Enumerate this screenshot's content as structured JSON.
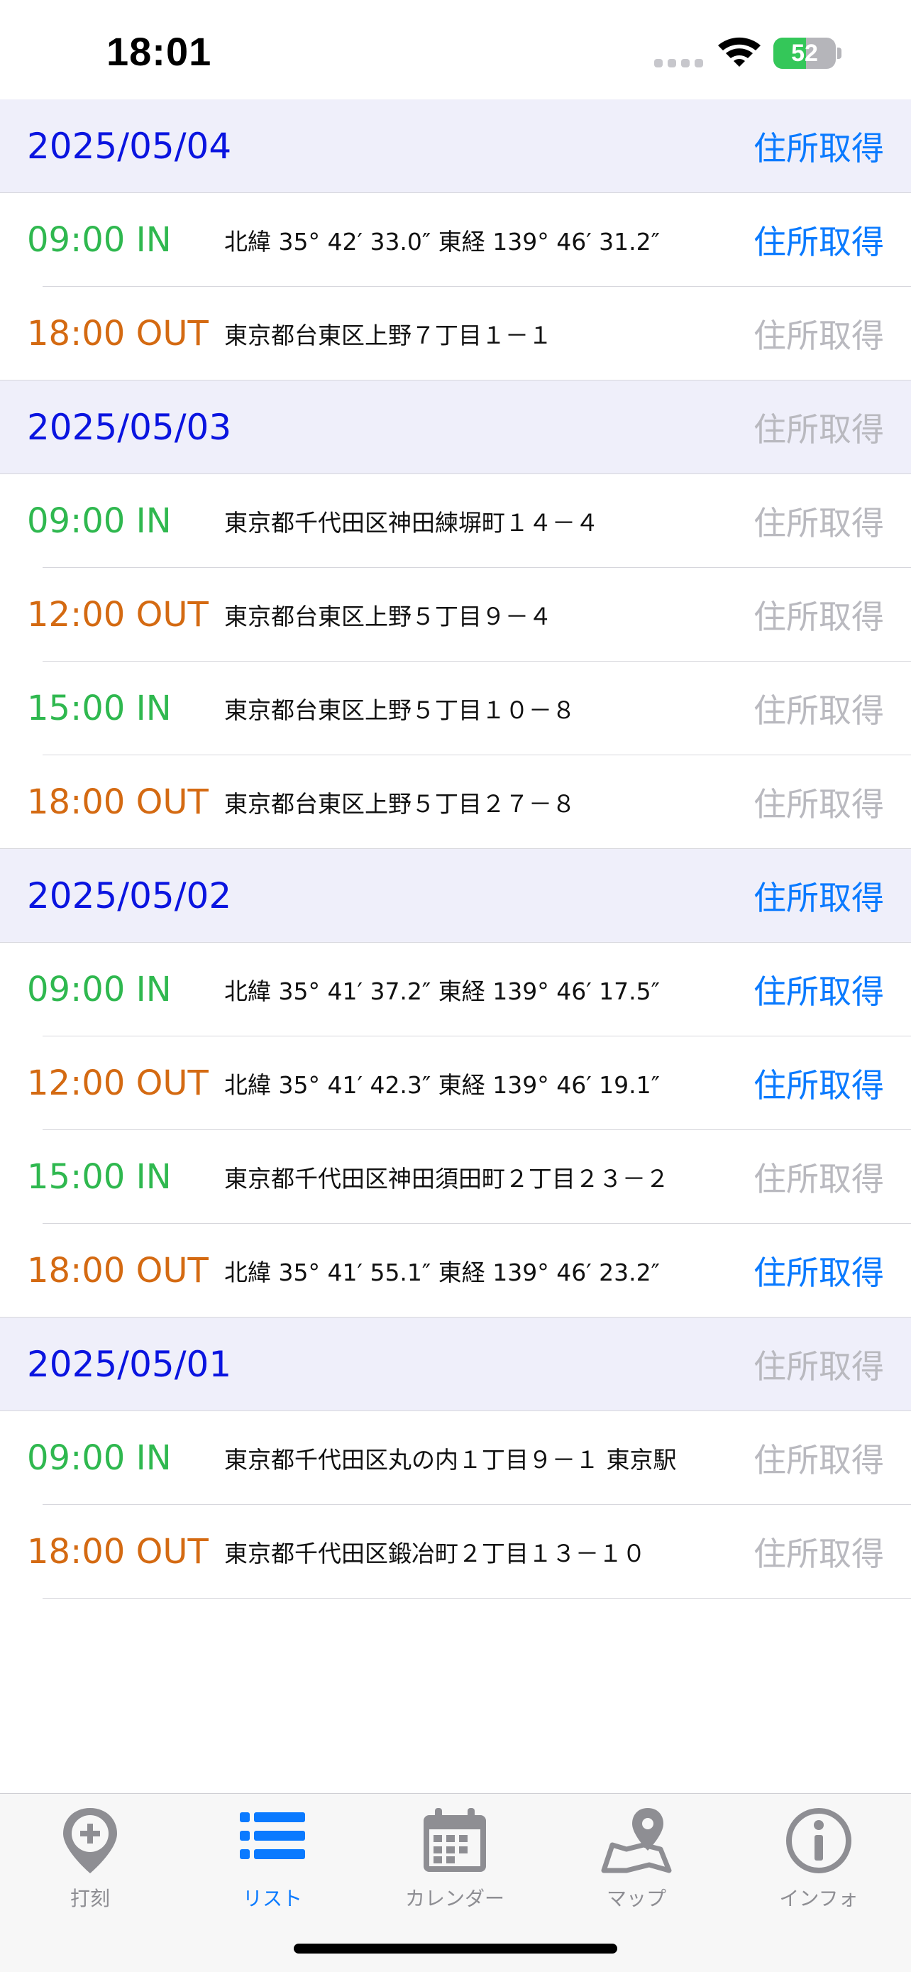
{
  "status_bar": {
    "time": "18:01",
    "battery_level": "52",
    "battery_percent": 52,
    "battery_color": "#34c759"
  },
  "colors": {
    "date_text": "#0a14e0",
    "header_bg": "#efeffa",
    "in_color": "#2fb84f",
    "out_color": "#d46a12",
    "action_enabled": "#0a7aff",
    "action_disabled": "#b9b9bf",
    "tab_active": "#0a7aff",
    "tab_inactive": "#8e8e93"
  },
  "groups": [
    {
      "date": "2025/05/04",
      "action_label": "住所取得",
      "action_enabled": true,
      "entries": [
        {
          "time": "09:00 IN",
          "kind": "in",
          "address": "北緯 35° 42′ 33.0″ 東経 139° 46′ 31.2″",
          "action_label": "住所取得",
          "action_enabled": true
        },
        {
          "time": "18:00 OUT",
          "kind": "out",
          "address": "東京都台東区上野７丁目１－１",
          "action_label": "住所取得",
          "action_enabled": false
        }
      ]
    },
    {
      "date": "2025/05/03",
      "action_label": "住所取得",
      "action_enabled": false,
      "entries": [
        {
          "time": "09:00 IN",
          "kind": "in",
          "address": "東京都千代田区神田練塀町１４－４",
          "action_label": "住所取得",
          "action_enabled": false
        },
        {
          "time": "12:00 OUT",
          "kind": "out",
          "address": "東京都台東区上野５丁目９－４",
          "action_label": "住所取得",
          "action_enabled": false
        },
        {
          "time": "15:00 IN",
          "kind": "in",
          "address": "東京都台東区上野５丁目１０－８",
          "action_label": "住所取得",
          "action_enabled": false
        },
        {
          "time": "18:00 OUT",
          "kind": "out",
          "address": "東京都台東区上野５丁目２７－８",
          "action_label": "住所取得",
          "action_enabled": false
        }
      ]
    },
    {
      "date": "2025/05/02",
      "action_label": "住所取得",
      "action_enabled": true,
      "entries": [
        {
          "time": "09:00 IN",
          "kind": "in",
          "address": "北緯 35° 41′ 37.2″ 東経 139° 46′ 17.5″",
          "action_label": "住所取得",
          "action_enabled": true
        },
        {
          "time": "12:00 OUT",
          "kind": "out",
          "address": "北緯 35° 41′ 42.3″ 東経 139° 46′ 19.1″",
          "action_label": "住所取得",
          "action_enabled": true
        },
        {
          "time": "15:00 IN",
          "kind": "in",
          "address": "東京都千代田区神田須田町２丁目２３－２",
          "action_label": "住所取得",
          "action_enabled": false
        },
        {
          "time": "18:00 OUT",
          "kind": "out",
          "address": "北緯 35° 41′ 55.1″ 東経 139° 46′ 23.2″",
          "action_label": "住所取得",
          "action_enabled": true
        }
      ]
    },
    {
      "date": "2025/05/01",
      "action_label": "住所取得",
      "action_enabled": false,
      "entries": [
        {
          "time": "09:00 IN",
          "kind": "in",
          "address": "東京都千代田区丸の内１丁目９－１ 東京駅",
          "action_label": "住所取得",
          "action_enabled": false
        },
        {
          "time": "18:00 OUT",
          "kind": "out",
          "address": "東京都千代田区鍛冶町２丁目１３－１０",
          "action_label": "住所取得",
          "action_enabled": false
        }
      ]
    }
  ],
  "tabs": [
    {
      "label": "打刻",
      "icon": "map-pin-plus-icon",
      "active": false
    },
    {
      "label": "リスト",
      "icon": "list-icon",
      "active": true
    },
    {
      "label": "カレンダー",
      "icon": "calendar-icon",
      "active": false
    },
    {
      "label": "マップ",
      "icon": "map-icon",
      "active": false
    },
    {
      "label": "インフォ",
      "icon": "info-icon",
      "active": false
    }
  ]
}
